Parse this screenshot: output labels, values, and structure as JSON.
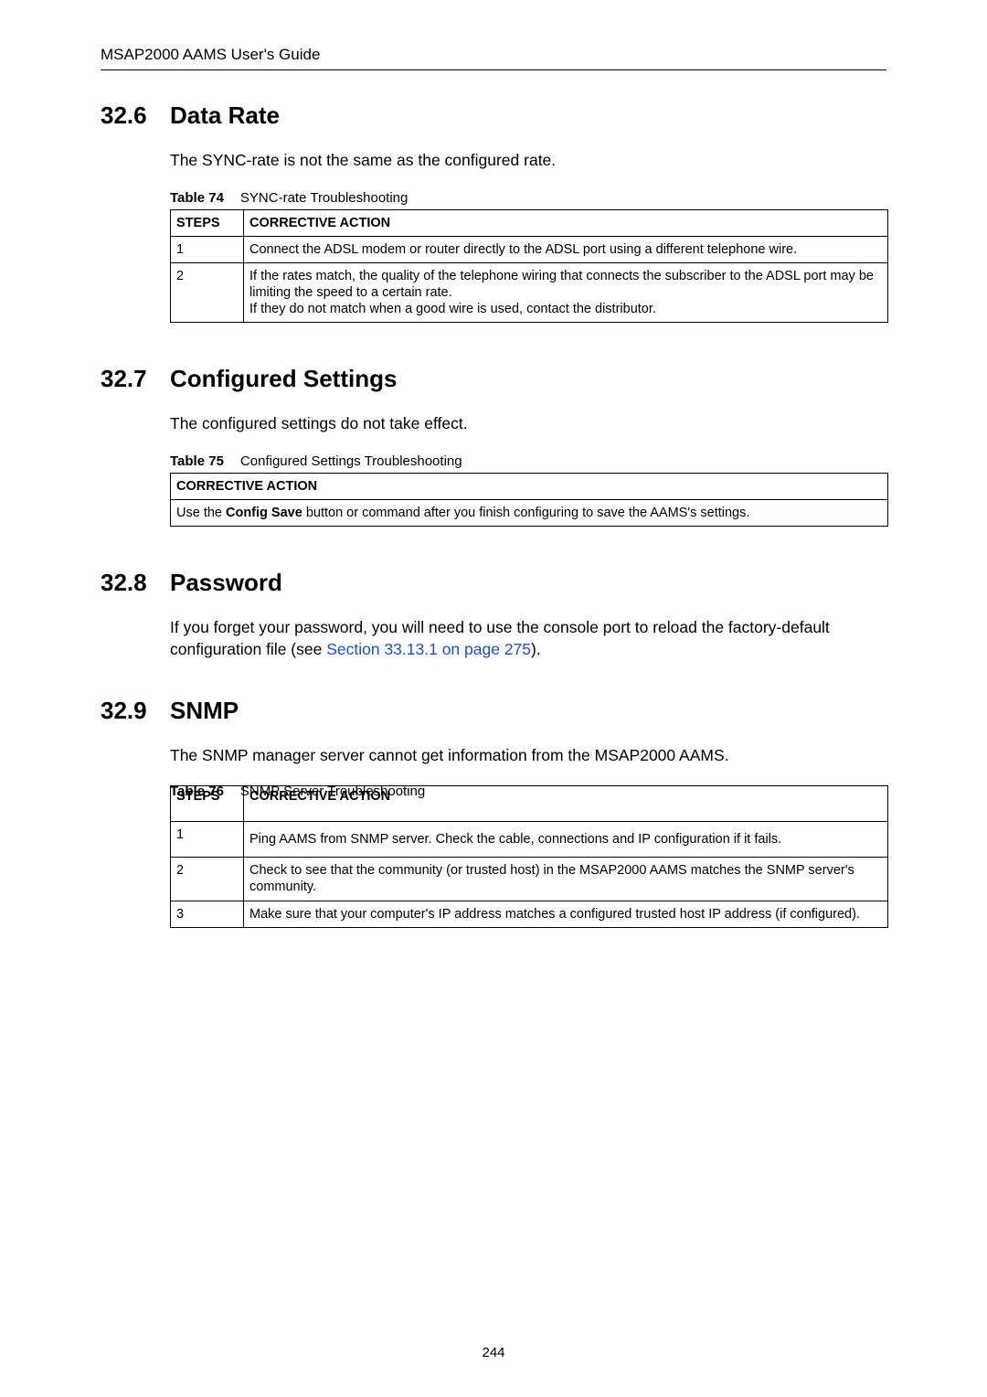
{
  "header": "MSAP2000 AAMS User's Guide",
  "page_number": "244",
  "sections": {
    "data_rate": {
      "num": "32.6",
      "title": "Data Rate",
      "intro": "The SYNC-rate is not the same as the configured rate.",
      "table_label": "Table 74",
      "table_title": "SYNC-rate Troubleshooting",
      "col_steps": "STEPS",
      "col_action": "CORRECTIVE ACTION",
      "rows": [
        {
          "step": "1",
          "action": "Connect the ADSL modem or router directly to the ADSL port using a different telephone wire."
        },
        {
          "step": "2",
          "action": "If the rates match, the quality of the telephone wiring that connects the subscriber to the ADSL port may be limiting the speed to a certain rate.\nIf they do not match when a good wire is used, contact the distributor."
        }
      ]
    },
    "configured": {
      "num": "32.7",
      "title": "Configured Settings",
      "intro": "The configured settings do not take effect.",
      "table_label": "Table 75",
      "table_title": "Configured Settings Troubleshooting",
      "col_action": "CORRECTIVE ACTION",
      "row_pre": "Use the ",
      "row_bold": "Config Save",
      "row_post": " button or command after you finish configuring to save the AAMS's settings."
    },
    "password": {
      "num": "32.8",
      "title": "Password",
      "text_pre": "If you forget your password, you will need to use the console port to reload the factory-default configuration file (see ",
      "link": "Section 33.13.1 on page 275",
      "text_post": ")."
    },
    "snmp": {
      "num": "32.9",
      "title": "SNMP",
      "intro": "The SNMP manager server cannot get information from the MSAP2000 AAMS.",
      "table_label": "Table 76",
      "table_title": "SNMP Server Troubleshooting",
      "col_steps": "STEPS",
      "col_action": "CORRECTIVE ACTION",
      "rows": [
        {
          "step": "1",
          "action": "Ping AAMS from SNMP server. Check the cable, connections and IP configuration if it fails."
        },
        {
          "step": "2",
          "action": "Check to see that the community (or trusted host) in the MSAP2000 AAMS matches the SNMP server's community."
        },
        {
          "step": "3",
          "action": "Make sure that your computer's IP address matches a configured trusted host IP address (if configured)."
        }
      ]
    }
  }
}
